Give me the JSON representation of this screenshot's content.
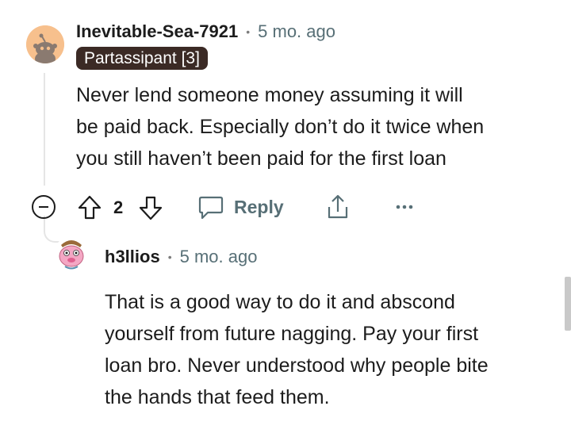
{
  "comments": [
    {
      "username": "Inevitable-Sea-7921",
      "separator": "•",
      "time": "5 mo. ago",
      "flair": "Partassipant [3]",
      "body_lines": [
        "Never lend someone money assuming it will",
        "be paid back. Especially don’t do it twice when",
        "you still haven’t been paid for the first loan"
      ],
      "score": "2",
      "reply_label": "Reply"
    },
    {
      "username": "h3llios",
      "separator": "•",
      "time": "5 mo. ago",
      "body_lines": [
        "That is a good way to do it and abscond",
        "yourself from future nagging. Pay your first",
        "loan bro. Never understood why people bite",
        "the hands that feed them."
      ]
    }
  ],
  "icons": {
    "collapse": "collapse-minus-icon",
    "upvote": "upvote-arrow-icon",
    "downvote": "downvote-arrow-icon",
    "reply": "speech-bubble-icon",
    "share": "share-icon",
    "more": "more-dots-icon"
  },
  "colors": {
    "flair_bg": "#3b2a25",
    "meta_text": "#576f76",
    "thread_line": "#e5e5e5",
    "avatar1_bg": "#f7c08d",
    "avatar2_accent": "#f4a7c4"
  }
}
